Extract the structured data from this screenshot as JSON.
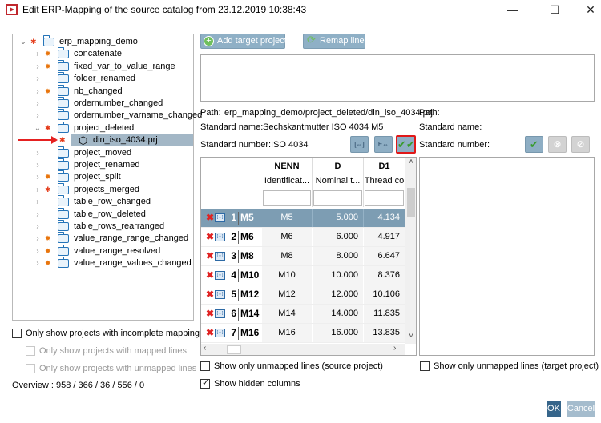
{
  "window": {
    "title": "Edit ERP-Mapping of the source catalog from 23.12.2019 10:38:43",
    "minimize": "—",
    "maximize": "☐",
    "close": "✕"
  },
  "tree": {
    "items": [
      {
        "label": "erp_mapping_demo",
        "level": 0,
        "expanded": true,
        "mark": "star",
        "icon": "folder-open"
      },
      {
        "label": "concatenate",
        "level": 1,
        "mark": "gear",
        "icon": "folder"
      },
      {
        "label": "fixed_var_to_value_range",
        "level": 1,
        "mark": "gear",
        "icon": "folder"
      },
      {
        "label": "folder_renamed",
        "level": 1,
        "mark": "",
        "icon": "folder"
      },
      {
        "label": "nb_changed",
        "level": 1,
        "mark": "gear",
        "icon": "folder"
      },
      {
        "label": "ordernumber_changed",
        "level": 1,
        "mark": "",
        "icon": "folder"
      },
      {
        "label": "ordernumber_varname_changed",
        "level": 1,
        "mark": "",
        "icon": "folder"
      },
      {
        "label": "project_deleted",
        "level": 1,
        "expanded": true,
        "mark": "star",
        "icon": "folder-open"
      },
      {
        "label": "din_iso_4034.prj",
        "level": 2,
        "mark": "star",
        "icon": "project",
        "selected": true
      },
      {
        "label": "project_moved",
        "level": 1,
        "mark": "",
        "icon": "folder"
      },
      {
        "label": "project_renamed",
        "level": 1,
        "mark": "",
        "icon": "folder"
      },
      {
        "label": "project_split",
        "level": 1,
        "mark": "gear",
        "icon": "folder"
      },
      {
        "label": "projects_merged",
        "level": 1,
        "mark": "star",
        "icon": "folder"
      },
      {
        "label": "table_row_changed",
        "level": 1,
        "mark": "",
        "icon": "folder"
      },
      {
        "label": "table_row_deleted",
        "level": 1,
        "mark": "",
        "icon": "folder"
      },
      {
        "label": "table_rows_rearranged",
        "level": 1,
        "mark": "",
        "icon": "folder"
      },
      {
        "label": "value_range_range_changed",
        "level": 1,
        "mark": "gear",
        "icon": "folder"
      },
      {
        "label": "value_range_resolved",
        "level": 1,
        "mark": "gear",
        "icon": "folder"
      },
      {
        "label": "value_range_values_changed",
        "level": 1,
        "mark": "gear",
        "icon": "folder"
      }
    ]
  },
  "filters": {
    "incomplete": "Only show projects with incomplete mappings",
    "mapped": "Only show projects with mapped lines",
    "unmapped": "Only show projects with unmapped lines",
    "overview": "Overview : 958 / 366 / 36 / 556 / 0"
  },
  "toolbar": {
    "add_target": "Add target project",
    "remap": "Remap lines"
  },
  "source": {
    "path_label": "Path:",
    "path": "erp_mapping_demo/project_deleted/din_iso_4034.prj",
    "name_label": "Standard name:",
    "name": "Sechskantmutter ISO 4034 M5",
    "number_label": "Standard number:",
    "number": "ISO 4034"
  },
  "target": {
    "path_label": "Path:",
    "name_label": "Standard name:",
    "number_label": "Standard number:"
  },
  "table": {
    "columns": [
      {
        "key": "NENN",
        "desc": "Identificat..."
      },
      {
        "key": "D",
        "desc": "Nominal t..."
      },
      {
        "key": "D1",
        "desc": "Thread co"
      }
    ],
    "rows": [
      {
        "n": "1",
        "id": "M5",
        "cells": [
          "M5",
          "5.000",
          "4.134"
        ],
        "selected": true
      },
      {
        "n": "2",
        "id": "M6",
        "cells": [
          "M6",
          "6.000",
          "4.917"
        ]
      },
      {
        "n": "3",
        "id": "M8",
        "cells": [
          "M8",
          "8.000",
          "6.647"
        ]
      },
      {
        "n": "4",
        "id": "M10",
        "cells": [
          "M10",
          "10.000",
          "8.376"
        ]
      },
      {
        "n": "5",
        "id": "M12",
        "cells": [
          "M12",
          "12.000",
          "10.106"
        ]
      },
      {
        "n": "6",
        "id": "M14",
        "cells": [
          "M14",
          "14.000",
          "11.835"
        ]
      },
      {
        "n": "7",
        "id": "M16",
        "cells": [
          "M16",
          "16.000",
          "13.835"
        ]
      }
    ]
  },
  "options": {
    "unmapped_source": "Show only unmapped lines (source project)",
    "unmapped_target": "Show only unmapped lines (target project)",
    "hidden_columns": "Show hidden columns",
    "hidden_columns_checked": true
  },
  "footer": {
    "ok": "OK",
    "cancel": "Cancel"
  }
}
